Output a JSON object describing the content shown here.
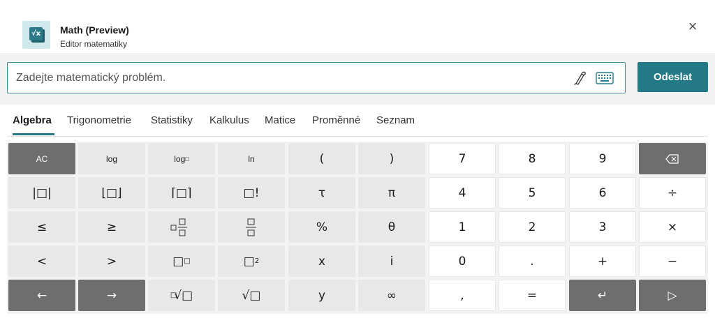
{
  "app": {
    "title": "Math (Preview)",
    "subtitle": "Editor matematiky",
    "icon": "square-root-icon",
    "close": "×"
  },
  "input": {
    "placeholder": "Zadejte matematický problém.",
    "value": "",
    "send_label": "Odeslat"
  },
  "tabs": [
    "Algebra",
    "Trigonometrie",
    "Statistiky",
    "Kalkulus",
    "Matice",
    "Proměnné",
    "Seznam"
  ],
  "active_tab": "Algebra",
  "colors": {
    "accent": "#237a86",
    "dark_key": "#6e6e6e",
    "fn_key": "#e8e8e8"
  },
  "keypad": {
    "r1": [
      "AC",
      "log",
      "log□",
      "ln",
      "(",
      ")",
      "7",
      "8",
      "9",
      "⌫"
    ],
    "r2": [
      "|□|",
      "⌊□⌋",
      "⌈□⌉",
      "□!",
      "τ",
      "π",
      "4",
      "5",
      "6",
      "÷"
    ],
    "r3": [
      "≤",
      "≥",
      "□□/□",
      "□/□",
      "%",
      "θ",
      "1",
      "2",
      "3",
      "×"
    ],
    "r4": [
      "<",
      ">",
      "□□",
      "□2",
      "x",
      "i",
      "0",
      ".",
      "+",
      "−"
    ],
    "r5": [
      "←",
      "→",
      "□√□",
      "√□",
      "y",
      "∞",
      ",",
      "=",
      "↵",
      "▷"
    ]
  }
}
